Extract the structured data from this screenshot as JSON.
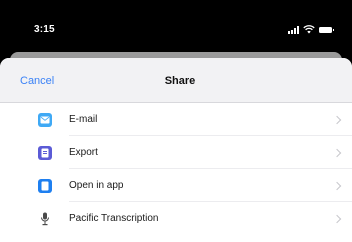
{
  "status_bar": {
    "time": "3:15"
  },
  "nav": {
    "cancel_label": "Cancel",
    "title": "Share"
  },
  "share_options": [
    {
      "label": "E-mail",
      "icon": "mail-icon",
      "color": "#3fa9f5"
    },
    {
      "label": "Export",
      "icon": "export-icon",
      "color": "#5b5bd6"
    },
    {
      "label": "Open in app",
      "icon": "open-in-app-icon",
      "color": "#1e7ff0"
    },
    {
      "label": "Pacific Transcription",
      "icon": "microphone-icon",
      "color": "#4a4a4a"
    }
  ],
  "colors": {
    "accent": "#3b82f6",
    "background": "#ffffff",
    "nav_background": "#f2f2f4"
  }
}
